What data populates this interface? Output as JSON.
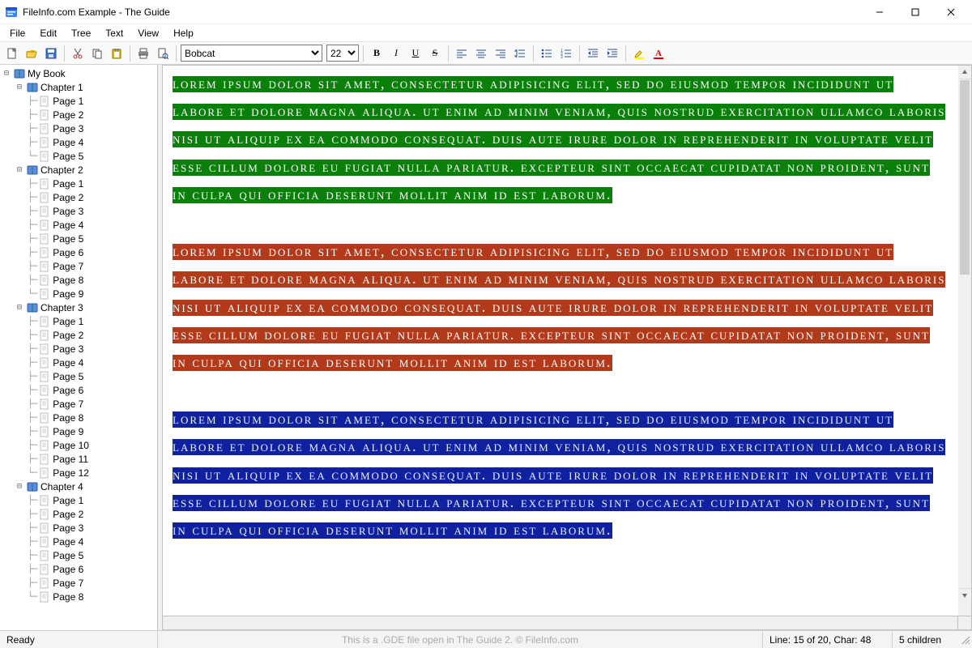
{
  "window": {
    "title": "FileInfo.com Example - The Guide"
  },
  "menu": {
    "items": [
      "File",
      "Edit",
      "Tree",
      "Text",
      "View",
      "Help"
    ]
  },
  "toolbar": {
    "font": "Bobcat",
    "size": "22",
    "icons": {
      "new": "new-icon",
      "open": "open-icon",
      "save": "save-icon",
      "cut": "cut-icon",
      "copy": "copy-icon",
      "paste": "paste-icon",
      "print": "print-icon",
      "preview": "preview-icon",
      "bold": "B",
      "italic": "I",
      "underline": "U",
      "strike": "S",
      "align_left": "align-left-icon",
      "align_center": "align-center-icon",
      "align_right": "align-right-icon",
      "line_spacing": "line-spacing-icon",
      "bullets": "bullets-icon",
      "numbers": "numbers-icon",
      "outdent": "outdent-icon",
      "indent": "indent-icon",
      "highlight": "highlight-icon",
      "font_color": "font-color-icon"
    }
  },
  "tree": {
    "root": {
      "label": "My Book",
      "expanded": true
    },
    "chapters": [
      {
        "label": "Chapter 1",
        "expanded": true,
        "pages": [
          "Page 1",
          "Page 2",
          "Page 3",
          "Page 4",
          "Page 5"
        ]
      },
      {
        "label": "Chapter 2",
        "expanded": true,
        "pages": [
          "Page 1",
          "Page 2",
          "Page 3",
          "Page 4",
          "Page 5",
          "Page 6",
          "Page 7",
          "Page 8",
          "Page 9"
        ]
      },
      {
        "label": "Chapter 3",
        "expanded": true,
        "pages": [
          "Page 1",
          "Page 2",
          "Page 3",
          "Page 4",
          "Page 5",
          "Page 6",
          "Page 7",
          "Page 8",
          "Page 9",
          "Page 10",
          "Page 11",
          "Page 12"
        ]
      },
      {
        "label": "Chapter 4",
        "expanded": true,
        "pages": [
          "Page 1",
          "Page 2",
          "Page 3",
          "Page 4",
          "Page 5",
          "Page 6",
          "Page 7",
          "Page 8"
        ]
      }
    ]
  },
  "editor": {
    "paragraphs": [
      {
        "style": "p1",
        "text": "Lorem ipsum dolor sit amet, consectetur adipisicing elit, sed do eiusmod tempor incididunt ut labore et dolore magna aliqua. Ut enim ad minim veniam, quis nostrud exercitation ullamco laboris nisi ut aliquip ex ea commodo consequat. Duis aute irure dolor in reprehenderit in voluptate velit esse cillum dolore eu fugiat nulla pariatur. Excepteur sint occaecat cupidatat non proident, sunt in culpa qui officia deserunt mollit anim id est laborum."
      },
      {
        "style": "p2",
        "text": "Lorem ipsum dolor sit amet, consectetur adipisicing elit, sed do eiusmod tempor incididunt ut labore et dolore magna aliqua. Ut enim ad minim veniam, quis nostrud exercitation ullamco laboris nisi ut aliquip ex ea commodo consequat. Duis aute irure dolor in reprehenderit in voluptate velit esse cillum dolore eu fugiat nulla pariatur. Excepteur sint occaecat cupidatat non proident, sunt in culpa qui officia deserunt mollit anim id est laborum."
      },
      {
        "style": "p3",
        "text": "Lorem ipsum dolor sit amet, consectetur adipisicing elit, sed do eiusmod tempor incididunt ut labore et dolore magna aliqua. Ut enim ad minim veniam, quis nostrud exercitation ullamco laboris nisi ut aliquip ex ea commodo consequat. Duis aute irure dolor in reprehenderit in voluptate velit esse cillum dolore eu fugiat nulla pariatur. Excepteur sint occaecat cupidatat non proident, sunt in culpa qui officia deserunt mollit anim id est laborum."
      }
    ]
  },
  "status": {
    "left": "Ready",
    "center": "This is a .GDE file open in The Guide 2. © FileInfo.com",
    "line_char": "Line: 15 of 20, Char: 48",
    "children": "5 children"
  }
}
